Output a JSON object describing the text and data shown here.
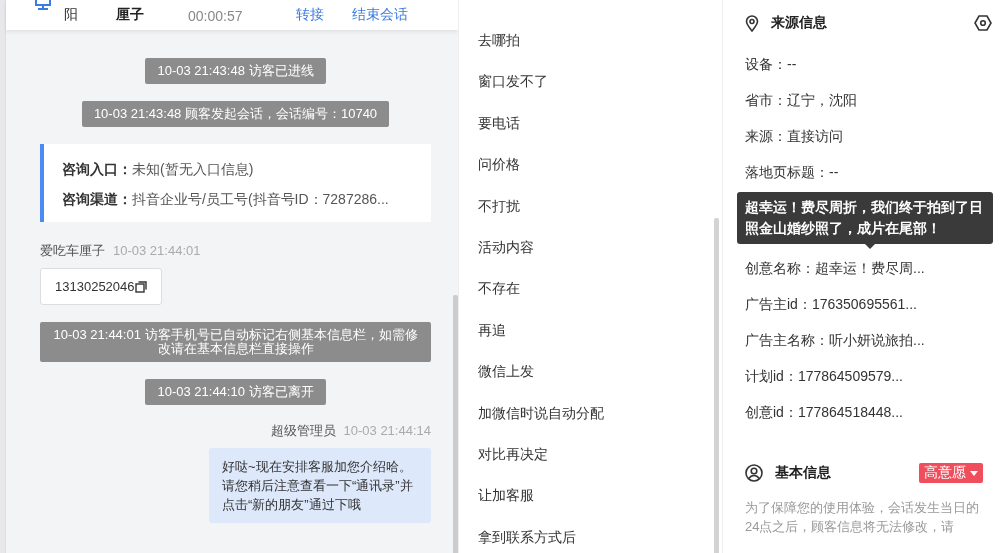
{
  "chat_header": {
    "name_fragment": "阳",
    "name": "厘子",
    "timer": "00:00:57",
    "actions": [
      "转接",
      "结束会话"
    ]
  },
  "messages": [
    {
      "kind": "system",
      "text": "10-03 21:43:48 访客已进线"
    },
    {
      "kind": "system",
      "text": "10-03 21:43:48 顾客发起会话，会话编号：10740"
    },
    {
      "kind": "info",
      "fields": [
        {
          "label": "咨询入口：",
          "value": "未知(暂无入口信息)"
        },
        {
          "label": "咨询渠道：",
          "value": "抖音企业号/员工号(抖音号ID：7287286..."
        }
      ]
    },
    {
      "kind": "visitor",
      "sender": "爱吃车厘子",
      "time": "10-03 21:44:01",
      "text": "13130252046"
    },
    {
      "kind": "system",
      "text": "10-03 21:44:01 访客手机号已自动标记右侧基本信息栏，如需修改请在基本信息栏直接操作"
    },
    {
      "kind": "system",
      "text": "10-03 21:44:10 访客已离开"
    },
    {
      "kind": "agent",
      "sender": "超级管理员",
      "time": "10-03 21:44:14",
      "text": "好哒~现在安排客服加您介绍哈。请您稍后注意查看一下“通讯录”并点击“新的朋友”通过下哦"
    }
  ],
  "quick_replies": [
    "去哪拍",
    "窗口发不了",
    "要电话",
    "问价格",
    "不打扰",
    "活动内容",
    "不存在",
    "再追",
    "微信上发",
    "加微信时说自动分配",
    "对比再决定",
    "让加客服",
    "拿到联系方式后"
  ],
  "source_info": {
    "title": "来源信息",
    "rows_before": [
      "设备：--",
      "省市：辽宁，沈阳",
      "来源：直接访问",
      "落地页标题：--"
    ],
    "tooltip": "超幸运！费尽周折，我们终于拍到了日照金山婚纱照了，成片在尾部！",
    "rows_after": [
      "创意名称：超幸运！费尽周...",
      "广告主id：176350695561...",
      "广告主名称：听小妍说旅拍...",
      "计划id：177864509579...",
      "创意id：177864518448..."
    ]
  },
  "basic_info": {
    "title": "基本信息",
    "intent_tag": "高意愿",
    "note": "为了保障您的使用体验，会话发生当日的24点之后，顾客信息将无法修改，请"
  }
}
